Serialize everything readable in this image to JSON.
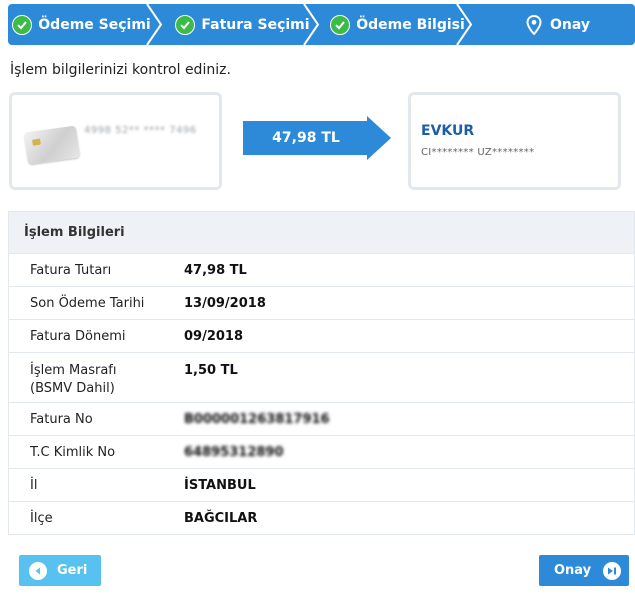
{
  "stepper": {
    "steps": [
      {
        "label": "Ödeme Seçimi",
        "status": "done"
      },
      {
        "label": "Fatura Seçimi",
        "status": "done"
      },
      {
        "label": "Ödeme Bilgisi",
        "status": "done"
      },
      {
        "label": "Onay",
        "status": "current"
      }
    ]
  },
  "instruction": "İşlem bilgilerinizi kontrol ediniz.",
  "card": {
    "masked_number": "4998 52** **** 7496"
  },
  "transfer": {
    "amount": "47,98 TL"
  },
  "merchant": {
    "name": "EVKUR",
    "holder": "CI******** UZ********"
  },
  "info": {
    "title": "İşlem Bilgileri",
    "rows": [
      {
        "key": "Fatura Tutarı",
        "value": "47,98 TL"
      },
      {
        "key": "Son Ödeme Tarihi",
        "value": "13/09/2018"
      },
      {
        "key": "Fatura Dönemi",
        "value": "09/2018"
      },
      {
        "key": "İşlem Masrafı (BSMV Dahil)",
        "value": "1,50 TL"
      },
      {
        "key": "Fatura No",
        "value": "B000001263817916"
      },
      {
        "key": "T.C Kimlik No",
        "value": "64895312890"
      },
      {
        "key": "İl",
        "value": "İSTANBUL"
      },
      {
        "key": "İlçe",
        "value": "BAĞCILAR"
      }
    ]
  },
  "buttons": {
    "back": "Geri",
    "confirm": "Onay"
  },
  "colors": {
    "primary": "#2d8ad8",
    "secondary": "#57c2ef",
    "success": "#3dbb49",
    "merchant": "#1d5fa7"
  }
}
